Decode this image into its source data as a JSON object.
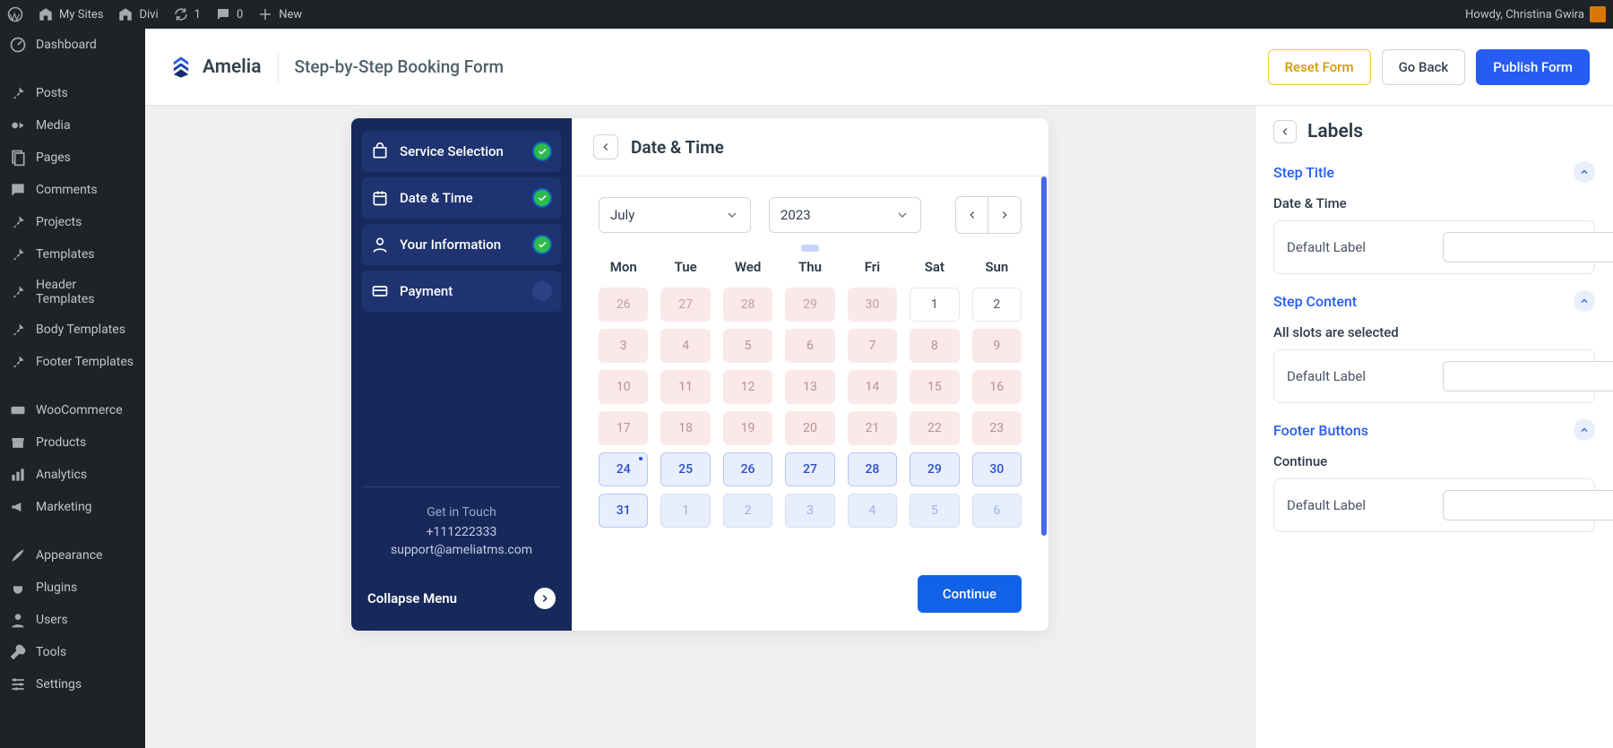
{
  "wp_adminbar": {
    "my_sites": "My Sites",
    "site_name": "Divi",
    "updates": "1",
    "comments": "0",
    "new": "New",
    "howdy": "Howdy, Christina Gwira"
  },
  "wp_menu": {
    "dashboard": "Dashboard",
    "posts": "Posts",
    "media": "Media",
    "pages": "Pages",
    "comments": "Comments",
    "projects": "Projects",
    "templates": "Templates",
    "header_templates": "Header Templates",
    "body_templates": "Body Templates",
    "footer_templates": "Footer Templates",
    "woocommerce": "WooCommerce",
    "products": "Products",
    "analytics": "Analytics",
    "marketing": "Marketing",
    "appearance": "Appearance",
    "plugins": "Plugins",
    "users": "Users",
    "tools": "Tools",
    "settings": "Settings"
  },
  "amelia": {
    "brand": "Amelia",
    "breadcrumb": "Step-by-Step Booking Form",
    "reset": "Reset Form",
    "go_back": "Go Back",
    "publish": "Publish Form"
  },
  "booking": {
    "steps": {
      "service": "Service Selection",
      "datetime": "Date & Time",
      "info": "Your Information",
      "payment": "Payment"
    },
    "contact": {
      "title": "Get in Touch",
      "phone": "+111222333",
      "email": "support@ameliatms.com"
    },
    "collapse": "Collapse Menu",
    "main_title": "Date & Time",
    "month": "July",
    "year": "2023",
    "weekdays": [
      "Mon",
      "Tue",
      "Wed",
      "Thu",
      "Fri",
      "Sat",
      "Sun"
    ],
    "rows": [
      [
        {
          "n": "26",
          "t": "prev"
        },
        {
          "n": "27",
          "t": "prev"
        },
        {
          "n": "28",
          "t": "prev"
        },
        {
          "n": "29",
          "t": "prev"
        },
        {
          "n": "30",
          "t": "prev"
        },
        {
          "n": "1",
          "t": "curr"
        },
        {
          "n": "2",
          "t": "curr"
        }
      ],
      [
        {
          "n": "3",
          "t": "past"
        },
        {
          "n": "4",
          "t": "past"
        },
        {
          "n": "5",
          "t": "past"
        },
        {
          "n": "6",
          "t": "past"
        },
        {
          "n": "7",
          "t": "past"
        },
        {
          "n": "8",
          "t": "past"
        },
        {
          "n": "9",
          "t": "past"
        }
      ],
      [
        {
          "n": "10",
          "t": "past"
        },
        {
          "n": "11",
          "t": "past"
        },
        {
          "n": "12",
          "t": "past"
        },
        {
          "n": "13",
          "t": "past"
        },
        {
          "n": "14",
          "t": "past"
        },
        {
          "n": "15",
          "t": "past"
        },
        {
          "n": "16",
          "t": "past"
        }
      ],
      [
        {
          "n": "17",
          "t": "past"
        },
        {
          "n": "18",
          "t": "past"
        },
        {
          "n": "19",
          "t": "past"
        },
        {
          "n": "20",
          "t": "past"
        },
        {
          "n": "21",
          "t": "past"
        },
        {
          "n": "22",
          "t": "past"
        },
        {
          "n": "23",
          "t": "past"
        }
      ],
      [
        {
          "n": "24",
          "t": "avail",
          "dot": true
        },
        {
          "n": "25",
          "t": "avail"
        },
        {
          "n": "26",
          "t": "avail"
        },
        {
          "n": "27",
          "t": "avail"
        },
        {
          "n": "28",
          "t": "avail"
        },
        {
          "n": "29",
          "t": "avail"
        },
        {
          "n": "30",
          "t": "avail"
        }
      ],
      [
        {
          "n": "31",
          "t": "avail"
        },
        {
          "n": "1",
          "t": "next"
        },
        {
          "n": "2",
          "t": "next"
        },
        {
          "n": "3",
          "t": "next"
        },
        {
          "n": "4",
          "t": "next"
        },
        {
          "n": "5",
          "t": "next"
        },
        {
          "n": "6",
          "t": "next"
        }
      ]
    ],
    "continue": "Continue"
  },
  "panel": {
    "title": "Labels",
    "sections": {
      "step_title": {
        "heading": "Step Title",
        "field_label": "Date & Time",
        "default_label": "Default Label"
      },
      "step_content": {
        "heading": "Step Content",
        "field_label": "All slots are selected",
        "default_label": "Default Label"
      },
      "footer_buttons": {
        "heading": "Footer Buttons",
        "field_label": "Continue",
        "default_label": "Default Label"
      }
    }
  }
}
